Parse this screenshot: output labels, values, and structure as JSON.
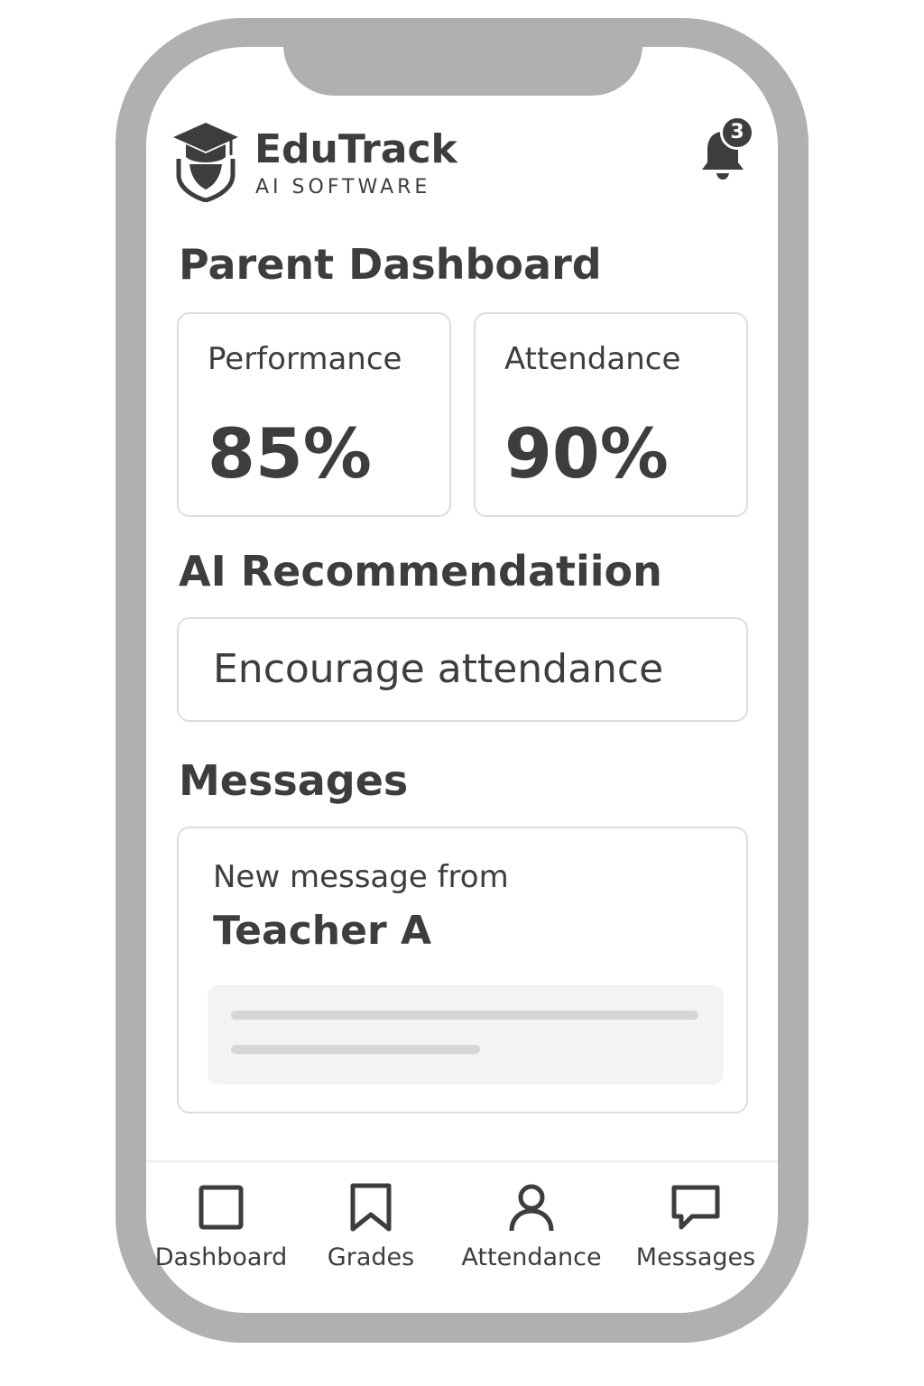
{
  "app": {
    "brand_name": "EduTrack",
    "brand_tagline": "AI SOFTWARE",
    "notification_count": "3",
    "logo_icon": "graduation-cap-shield-icon",
    "notification_icon": "bell-icon"
  },
  "dashboard": {
    "title": "Parent Dashboard",
    "stats": [
      {
        "label": "Performance",
        "value": "85%"
      },
      {
        "label": "Attendance",
        "value": "90%"
      }
    ]
  },
  "recommendation": {
    "title": "AI Recommendatiion",
    "text": "Encourage attendance"
  },
  "messages": {
    "title": "Messages",
    "item": {
      "line1": "New message from",
      "line2": "Teacher A"
    }
  },
  "nav": {
    "items": [
      {
        "label": "Dashboard",
        "icon": "square-icon"
      },
      {
        "label": "Grades",
        "icon": "bookmark-icon"
      },
      {
        "label": "Attendance",
        "icon": "person-icon"
      },
      {
        "label": "Messages",
        "icon": "chat-bubble-icon"
      }
    ]
  },
  "colors": {
    "frame": "#b0b0b0",
    "text": "#3d3d3d",
    "card_border": "#dddddd",
    "preview_bg": "#f3f3f3"
  }
}
